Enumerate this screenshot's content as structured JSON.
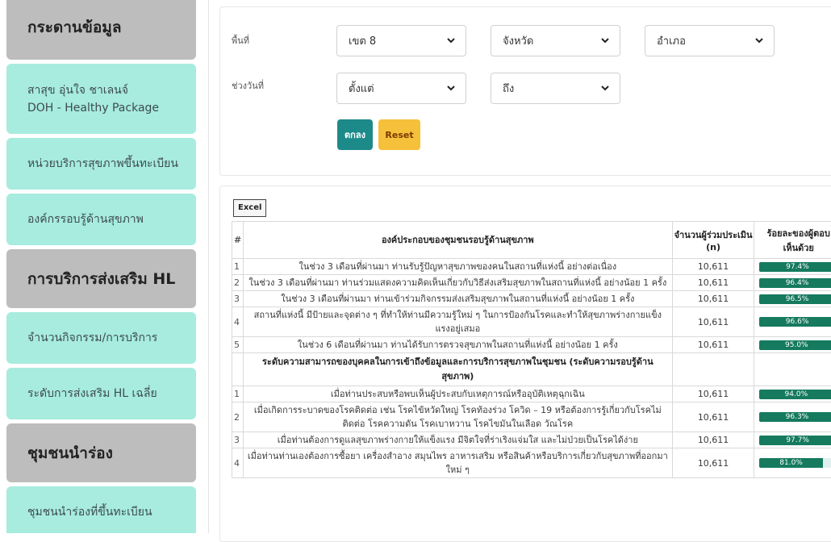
{
  "sidebar": {
    "items": [
      {
        "type": "head",
        "label": "กระดานข้อมูล"
      },
      {
        "type": "item",
        "line1": "สาสุข อุ่นใจ ชาเลนจ์",
        "line2": "DOH - Healthy Package"
      },
      {
        "type": "item",
        "label": "หน่วยบริการสุขภาพขึ้นทะเบียน"
      },
      {
        "type": "item",
        "label": "องค์กรรอบรู้ด้านสุขภาพ"
      },
      {
        "type": "head",
        "label": "การบริการส่งเสริม HL"
      },
      {
        "type": "item",
        "label": "จำนวนกิจกรรม/การบริการ"
      },
      {
        "type": "item",
        "label": "ระดับการส่งเสริม HL เฉลี่ย"
      },
      {
        "type": "head",
        "label": "ชุมชนนำร่อง"
      },
      {
        "type": "item",
        "label": "ชุมชนนำร่องที่ขึ้นทะเบียน"
      }
    ]
  },
  "filters": {
    "area_label": "พื้นที่",
    "date_label": "ช่วงวันที่",
    "zone": "เขต 8",
    "province": "จังหวัด",
    "district": "อำเภอ",
    "from": "ตั้งแต่",
    "to": "ถึง",
    "ok_label": "ตกลง",
    "reset_label": "Reset"
  },
  "table": {
    "excel_label": "Excel",
    "headers": {
      "num": "#",
      "component": "องค์ประกอบของชุมชนรอบรู้ด้านสุขภาพ",
      "count": "จำนวนผู้ร่วมประเมิน (n)",
      "percent": "ร้อยละของผู้ตอบเห็นด้วย"
    },
    "rows": [
      {
        "num": "1",
        "text": "ในช่วง 3 เดือนที่ผ่านมา ท่านรับรู้ปัญหาสุขภาพของคนในสถานที่แห่งนี้ อย่างต่อเนื่อง",
        "count": "10,611",
        "percent": 97.4,
        "percent_label": "97.4%"
      },
      {
        "num": "2",
        "text": "ในช่วง 3 เดือนที่ผ่านมา ท่านร่วมแสดงความคิดเห็นเกี่ยวกับวิธีส่งเสริมสุขภาพในสถานที่แห่งนี้ อย่างน้อย 1 ครั้ง",
        "count": "10,611",
        "percent": 96.4,
        "percent_label": "96.4%"
      },
      {
        "num": "3",
        "text": "ในช่วง 3 เดือนที่ผ่านมา ท่านเข้าร่วมกิจกรรมส่งเสริมสุขภาพในสถานที่แห่งนี้ อย่างน้อย 1 ครั้ง",
        "count": "10,611",
        "percent": 96.5,
        "percent_label": "96.5%"
      },
      {
        "num": "4",
        "text": "สถานที่แห่งนี้ มีป้ายและจุดต่าง ๆ ที่ทำให้ท่านมีความรู้ใหม่ ๆ ในการป้องกันโรคและทำให้สุขภาพร่างกายแข็งแรงอยู่เสมอ",
        "count": "10,611",
        "percent": 96.6,
        "percent_label": "96.6%"
      },
      {
        "num": "5",
        "text": "ในช่วง 6 เดือนที่ผ่านมา ท่านได้รับการตรวจสุขภาพในสถานที่แห่งนี้ อย่างน้อย 1 ครั้ง",
        "count": "10,611",
        "percent": 95.0,
        "percent_label": "95.0%"
      }
    ],
    "section_title": "ระดับความสามารถของบุคคลในการเข้าถึงข้อมูลและการบริการสุขภาพในชุมชน (ระดับความรอบรู้ด้านสุขภาพ)",
    "rows2": [
      {
        "num": "1",
        "text": "เมื่อท่านประสบหรือพบเห็นผู้ประสบกับเหตุการณ์หรืออุบัติเหตุฉุกเฉิน",
        "count": "10,611",
        "percent": 94.0,
        "percent_label": "94.0%"
      },
      {
        "num": "2",
        "text": "เมื่อเกิดการระบาดของโรคติดต่อ เช่น โรคไข้หวัดใหญ่ โรคท้องร่วง โควิด – 19 หรือต้องการรู้เกี่ยวกับโรคไม่ติดต่อ โรคความดัน โรคเบาหวาน โรคไขมันในเลือด วัณโรค",
        "count": "10,611",
        "percent": 96.3,
        "percent_label": "96.3%"
      },
      {
        "num": "3",
        "text": "เมื่อท่านต้องการดูแลสุขภาพร่างกายให้แข็งแรง มีจิตใจที่ร่าเริงแจ่มใส และไม่ป่วยเป็นโรคได้ง่าย",
        "count": "10,611",
        "percent": 97.7,
        "percent_label": "97.7%"
      },
      {
        "num": "4",
        "text": "เมื่อท่านท่านเองต้องการซื้อยา เครื่องสำอาง สมุนไพร อาหารเสริม หรือสินค้าหรือบริการเกี่ยวกับสุขภาพที่ออกมาใหม่ ๆ",
        "count": "10,611",
        "percent": 81.0,
        "percent_label": "81.0%"
      }
    ]
  },
  "colors": {
    "sidebar_head": "#bdbdbd",
    "sidebar_item": "#a7ecde",
    "bar": "#157a5e",
    "ok_button": "#1d8a8a",
    "reset_button": "#f5c13b"
  }
}
